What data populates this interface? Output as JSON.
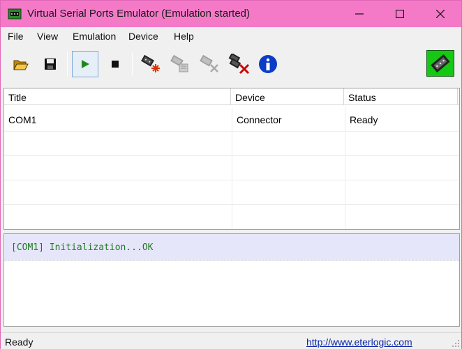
{
  "window": {
    "title": "Virtual Serial Ports Emulator (Emulation started)",
    "icons": {
      "app": "serial-port-app-icon",
      "minimize": "minimize-icon",
      "maximize": "maximize-icon",
      "close": "close-icon"
    }
  },
  "menu": {
    "items": [
      {
        "label": "File"
      },
      {
        "label": "View"
      },
      {
        "label": "Emulation"
      },
      {
        "label": "Device"
      },
      {
        "label": "Help"
      }
    ]
  },
  "toolbar": {
    "buttons": [
      {
        "icon": "open-folder-icon",
        "state": "enabled"
      },
      {
        "icon": "save-icon",
        "state": "enabled"
      },
      {
        "icon": "play-icon",
        "state": "pressed"
      },
      {
        "icon": "stop-icon",
        "state": "enabled"
      },
      {
        "icon": "new-device-icon",
        "state": "enabled"
      },
      {
        "icon": "device-properties-icon",
        "state": "disabled"
      },
      {
        "icon": "delete-device-icon",
        "state": "disabled"
      },
      {
        "icon": "delete-all-devices-icon",
        "state": "enabled"
      },
      {
        "icon": "info-icon",
        "state": "enabled"
      },
      {
        "icon": "connector-logo-icon",
        "state": "enabled"
      }
    ]
  },
  "devices": {
    "columns": [
      "Title",
      "Device",
      "Status"
    ],
    "rows": [
      {
        "title": "COM1",
        "device": "Connector",
        "status": "Ready"
      }
    ]
  },
  "log": {
    "lines": [
      "[COM1] Initialization...OK"
    ]
  },
  "statusbar": {
    "text": "Ready",
    "link": "http://www.eterlogic.com"
  },
  "colors": {
    "titlebar": "#f47ac8",
    "log_text": "#1f7a1f",
    "log_highlight": "#e6e6fa",
    "link": "#0b27a8"
  }
}
